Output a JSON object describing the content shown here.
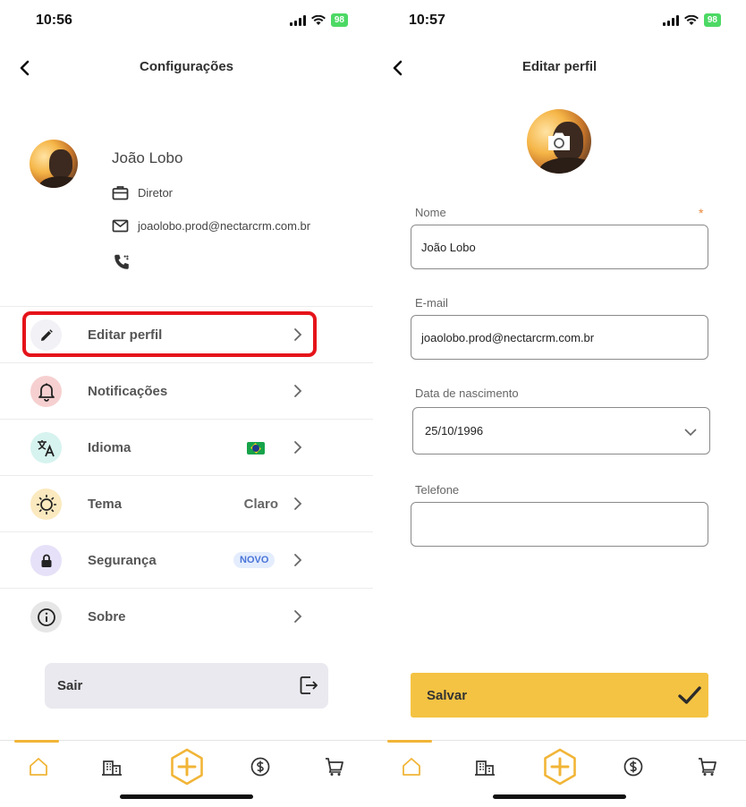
{
  "left_screen": {
    "status": {
      "time": "10:56",
      "battery": "98"
    },
    "header": {
      "title": "Configurações"
    },
    "profile": {
      "name": "João Lobo",
      "role": "Diretor",
      "email": "joaolobo.prod@nectarcrm.com.br"
    },
    "menu": [
      {
        "label": "Editar perfil",
        "icon": "pencil-icon",
        "icon_bg": "#f1f1f6"
      },
      {
        "label": "Notificações",
        "icon": "bell-icon",
        "icon_bg": "#f6d0d0"
      },
      {
        "label": "Idioma",
        "icon": "translate-icon",
        "icon_bg": "#d6f3ef",
        "flag": "brazil-flag"
      },
      {
        "label": "Tema",
        "icon": "sun-icon",
        "icon_bg": "#fbe9bf",
        "value": "Claro"
      },
      {
        "label": "Segurança",
        "icon": "lock-icon",
        "icon_bg": "#e6e1f8",
        "badge": "NOVO"
      },
      {
        "label": "Sobre",
        "icon": "info-icon",
        "icon_bg": "#e6e6e6"
      }
    ],
    "logout": {
      "label": "Sair"
    }
  },
  "right_screen": {
    "status": {
      "time": "10:57",
      "battery": "98"
    },
    "header": {
      "title": "Editar perfil"
    },
    "form": {
      "name_label": "Nome",
      "name_value": "João Lobo",
      "required_mark": "*",
      "email_label": "E-mail",
      "email_value": "joaolobo.prod@nectarcrm.com.br",
      "birth_label": "Data de nascimento",
      "birth_value": "25/10/1996",
      "phone_label": "Telefone",
      "phone_value": ""
    },
    "save": {
      "label": "Salvar"
    }
  },
  "colors": {
    "accent": "#f4c343",
    "nav_accent": "#f1b537",
    "highlight": "#e5141a"
  }
}
